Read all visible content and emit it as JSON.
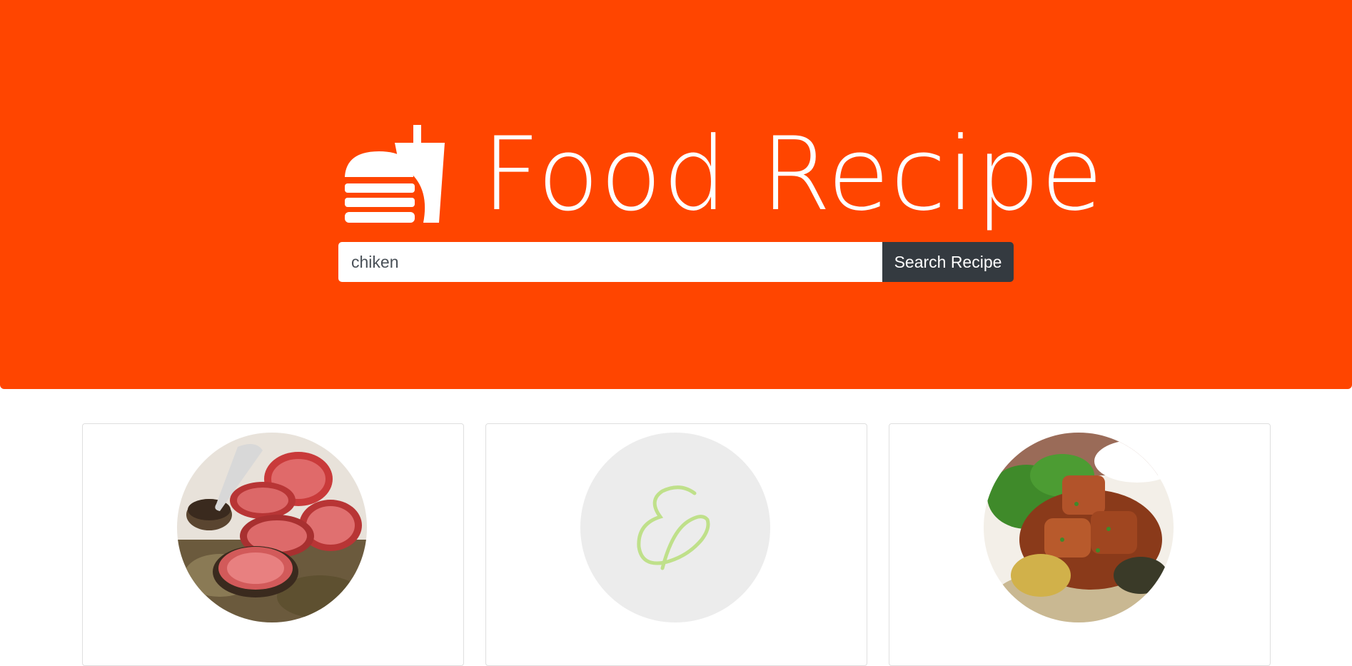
{
  "header": {
    "title": "Food Recipe",
    "logo_icon": "burger-drink-icon",
    "background_color": "#ff4500"
  },
  "search": {
    "value": "chiken",
    "button_label": "Search Recipe"
  },
  "results": [
    {
      "image_icon": "sliced-steak-photo"
    },
    {
      "image_icon": "placeholder-ampersand-image"
    },
    {
      "image_icon": "curry-chicken-photo"
    }
  ]
}
